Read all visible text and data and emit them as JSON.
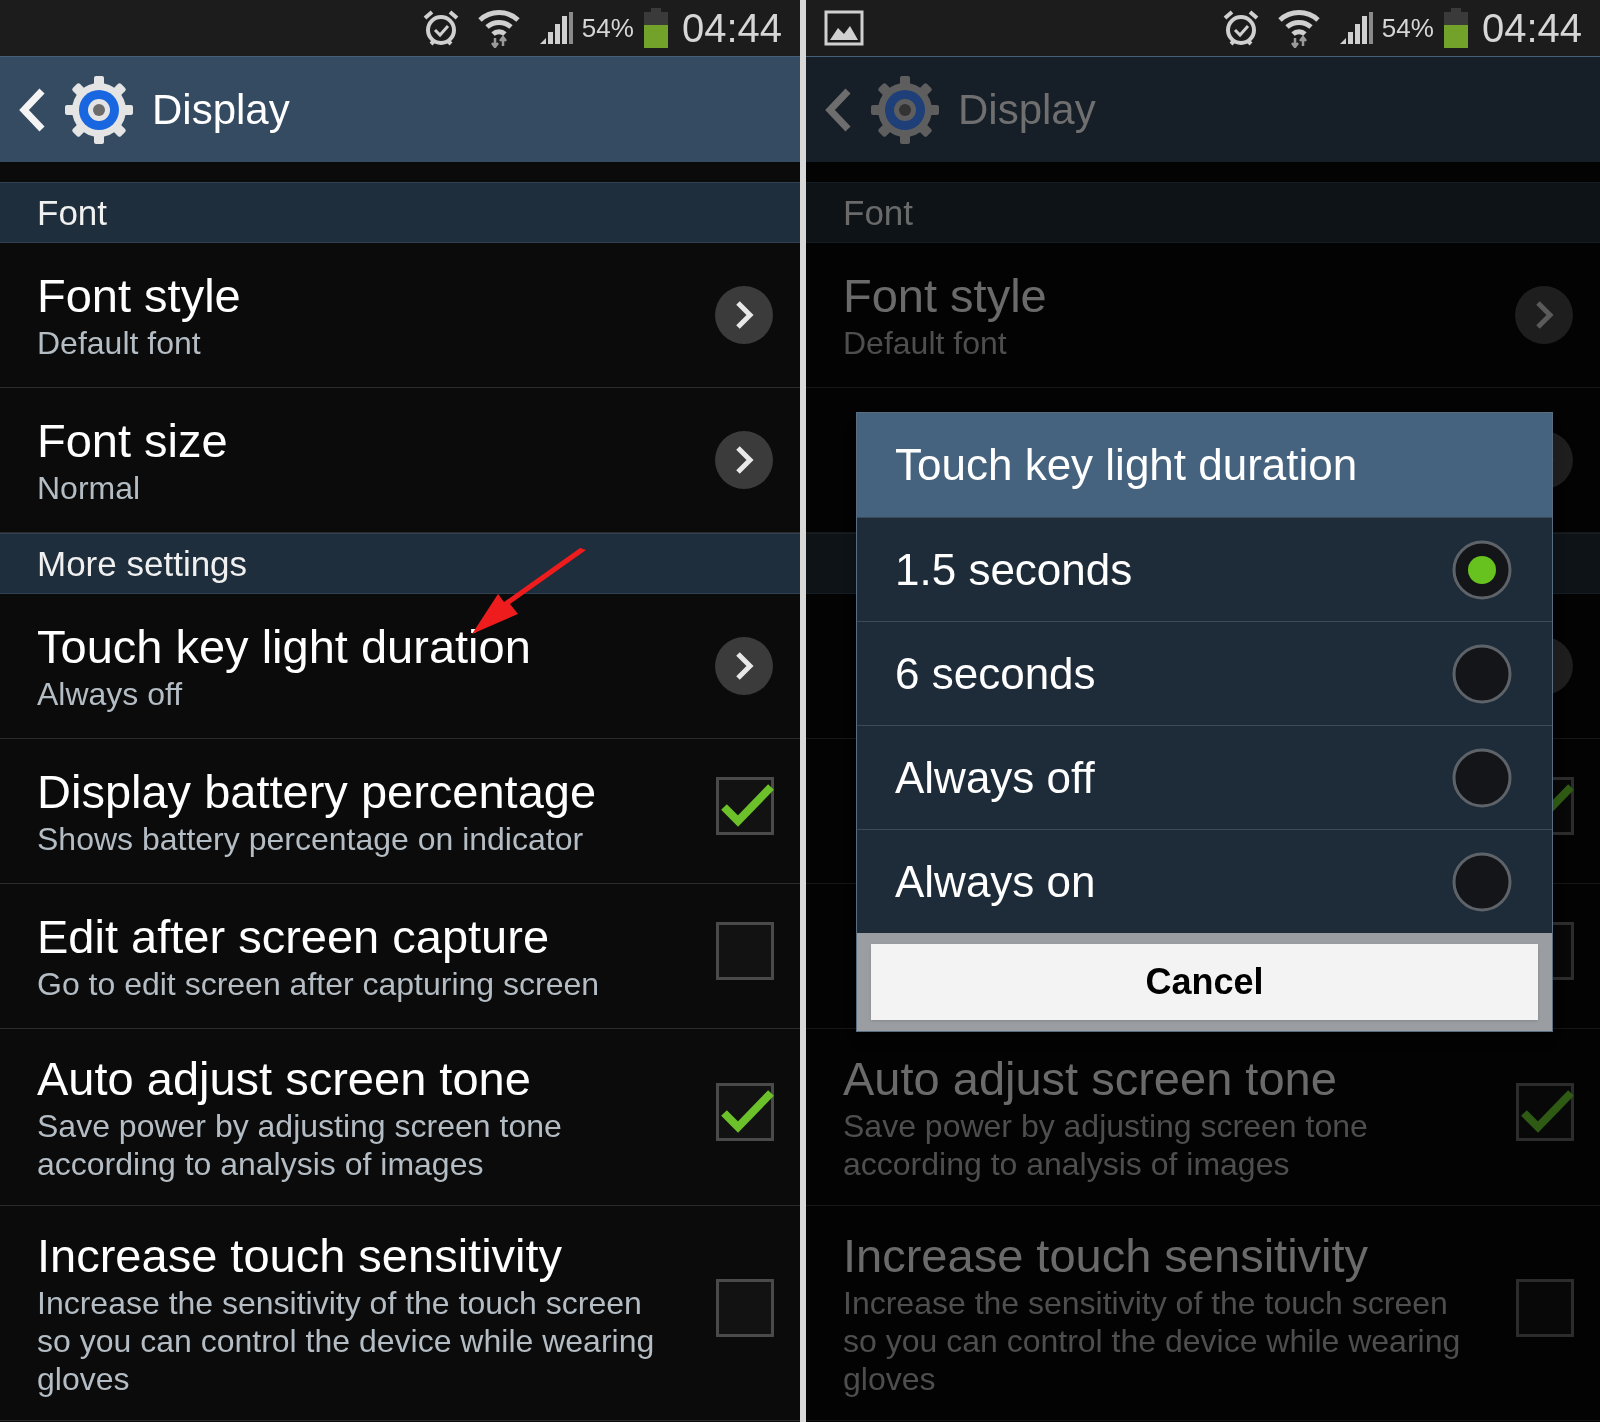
{
  "screens": [
    {
      "dimmed": false,
      "arrow_annotation": true,
      "status_bar": {
        "screenshot_notification": false,
        "battery": "54%",
        "time": "04:44"
      },
      "header": {
        "title": "Display"
      },
      "items": [
        {
          "kind": "section",
          "title": "Font"
        },
        {
          "kind": "link",
          "title": "Font style",
          "subtitle": "Default font"
        },
        {
          "kind": "link",
          "title": "Font size",
          "subtitle": "Normal"
        },
        {
          "kind": "section",
          "title": "More settings"
        },
        {
          "kind": "link",
          "title": "Touch key light duration",
          "subtitle": "Always off"
        },
        {
          "kind": "toggle",
          "title": "Display battery percentage",
          "subtitle": "Shows battery percentage on indicator",
          "checked": true
        },
        {
          "kind": "toggle",
          "title": "Edit after screen capture",
          "subtitle": "Go to edit screen after capturing screen",
          "checked": false
        },
        {
          "kind": "toggle",
          "title": "Auto adjust screen tone",
          "subtitle": "Save power by adjusting screen tone according to analysis of images",
          "checked": true
        },
        {
          "kind": "toggle",
          "title": "Increase touch sensitivity",
          "subtitle": "Increase the sensitivity of the touch screen so you can control the device while wearing gloves",
          "checked": false
        }
      ]
    },
    {
      "dimmed": true,
      "arrow_annotation": false,
      "status_bar": {
        "screenshot_notification": true,
        "battery": "54%",
        "time": "04:44"
      },
      "header": {
        "title": "Display"
      },
      "items": [
        {
          "kind": "section",
          "title": "Font"
        },
        {
          "kind": "link",
          "title": "Font style",
          "subtitle": "Default font"
        },
        {
          "kind": "link"
        },
        {
          "kind": "section"
        },
        {
          "kind": "link"
        },
        {
          "kind": "toggle",
          "checked": true
        },
        {
          "kind": "toggle",
          "checked": false
        },
        {
          "kind": "toggle",
          "title": "Auto adjust screen tone",
          "subtitle": "Save power by adjusting screen tone according to analysis of images",
          "checked": true
        },
        {
          "kind": "toggle",
          "title": "Increase touch sensitivity",
          "subtitle": "Increase the sensitivity of the touch screen so you can control the device while wearing gloves",
          "checked": false
        }
      ],
      "dialog": {
        "title": "Touch key light duration",
        "options": [
          {
            "label": "1.5 seconds",
            "selected": true
          },
          {
            "label": "6 seconds",
            "selected": false
          },
          {
            "label": "Always off",
            "selected": false
          },
          {
            "label": "Always on",
            "selected": false
          }
        ],
        "button": "Cancel"
      }
    }
  ]
}
